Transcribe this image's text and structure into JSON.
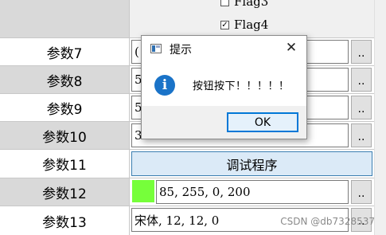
{
  "flags": {
    "flag3_label": "Flag3",
    "flag4_label": "Flag4",
    "flag4_checked": true
  },
  "rows": [
    {
      "label": "参数7",
      "value": "("
    },
    {
      "label": "参数8",
      "value": "5"
    },
    {
      "label": "参数9",
      "value": "5"
    },
    {
      "label": "参数10",
      "value": "3"
    },
    {
      "label": "参数11",
      "button": "调试程序"
    },
    {
      "label": "参数12",
      "value": "85, 255, 0, 200",
      "swatch_color": "#76ff3a"
    },
    {
      "label": "参数13",
      "value": "宋体, 12, 12, 0"
    }
  ],
  "dots_label": "..",
  "dialog": {
    "title": "提示",
    "close_glyph": "✕",
    "info_glyph": "i",
    "message": "按钮按下！！！！！",
    "ok_label": "OK"
  },
  "watermark": "CSDN @db7328537"
}
